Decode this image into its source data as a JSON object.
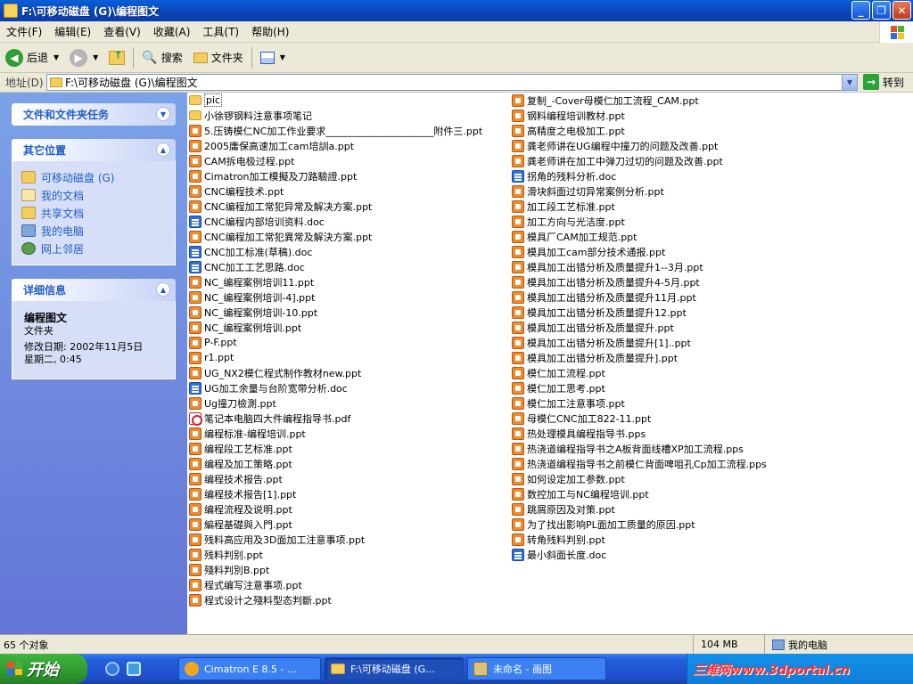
{
  "window": {
    "title": "F:\\可移动磁盘 (G)\\编程图文",
    "minimize": "_",
    "maximize": "❐",
    "close": "✕"
  },
  "menu": [
    "文件(F)",
    "编辑(E)",
    "查看(V)",
    "收藏(A)",
    "工具(T)",
    "帮助(H)"
  ],
  "toolbar": {
    "back": "后退",
    "search": "搜索",
    "folders": "文件夹"
  },
  "address": {
    "label": "地址(D)",
    "path": "F:\\可移动磁盘 (G)\\编程图文",
    "go": "转到"
  },
  "tasks": {
    "file_tasks_title": "文件和文件夹任务",
    "other_places_title": "其它位置",
    "other_places": [
      "可移动磁盘 (G)",
      "我的文档",
      "共享文档",
      "我的电脑",
      "网上邻居"
    ],
    "details_title": "详细信息",
    "details": {
      "name": "编程图文",
      "type": "文件夹",
      "modified": "修改日期: 2002年11月5日",
      "time": "星期二, 0:45"
    }
  },
  "files_col1": [
    {
      "name": "pic",
      "type": "folder"
    },
    {
      "name": "小徐锣钢料注意事项笔记",
      "type": "folder"
    },
    {
      "name": "5.压铸模仁NC加工作业要求______________________附件三.ppt",
      "type": "ppt"
    },
    {
      "name": "2005庸保高速加工cam培訓a.ppt",
      "type": "ppt"
    },
    {
      "name": "CAM拆电极过程.ppt",
      "type": "ppt"
    },
    {
      "name": "Cimatron加工模擬及刀路驗證.ppt",
      "type": "ppt"
    },
    {
      "name": "CNC编程技术.ppt",
      "type": "ppt"
    },
    {
      "name": "CNC编程加工常犯异常及解决方案.ppt",
      "type": "ppt"
    },
    {
      "name": "CNC编程内部培训资料.doc",
      "type": "doc"
    },
    {
      "name": "CNC编程加工常犯異常及解決方案.ppt",
      "type": "ppt"
    },
    {
      "name": "CNC加工标准(草稿).doc",
      "type": "doc"
    },
    {
      "name": "CNC加工工艺思路.doc",
      "type": "doc"
    },
    {
      "name": "NC_编程案例培训11.ppt",
      "type": "ppt"
    },
    {
      "name": "NC_编程案例培训-4].ppt",
      "type": "ppt"
    },
    {
      "name": "NC_编程案例培训-10.ppt",
      "type": "ppt"
    },
    {
      "name": "NC_编程案例培训.ppt",
      "type": "ppt"
    },
    {
      "name": "P-F.ppt",
      "type": "ppt"
    },
    {
      "name": "r1.ppt",
      "type": "ppt"
    },
    {
      "name": "UG_NX2模仁程式制作教材new.ppt",
      "type": "ppt"
    },
    {
      "name": "UG加工余量与台阶宽带分析.doc",
      "type": "doc"
    },
    {
      "name": "Ug撞刀檢測.ppt",
      "type": "ppt"
    },
    {
      "name": "笔记本电脑四大件编程指导书.pdf",
      "type": "pdf"
    },
    {
      "name": "编程标准-编程培训.ppt",
      "type": "ppt"
    },
    {
      "name": "编程段工艺标准.ppt",
      "type": "ppt"
    },
    {
      "name": "编程及加工策略.ppt",
      "type": "ppt"
    },
    {
      "name": "编程技术报告.ppt",
      "type": "ppt"
    },
    {
      "name": "编程技术报告[1].ppt",
      "type": "ppt"
    },
    {
      "name": "编程流程及说明.ppt",
      "type": "ppt"
    },
    {
      "name": "編程基礎與入門.ppt",
      "type": "ppt"
    },
    {
      "name": "残料高应用及3D面加工注意事项.ppt",
      "type": "ppt"
    },
    {
      "name": "残料判别.ppt",
      "type": "ppt"
    },
    {
      "name": "殘料判別B.ppt",
      "type": "ppt"
    },
    {
      "name": "程式编写注意事项.ppt",
      "type": "ppt"
    },
    {
      "name": "程式设计之殘料型态判斷.ppt",
      "type": "ppt"
    }
  ],
  "files_col2": [
    {
      "name": "复制_-Cover母模仁加工流程_CAM.ppt",
      "type": "ppt"
    },
    {
      "name": "钢料编程培训教材.ppt",
      "type": "ppt"
    },
    {
      "name": "高精度之电极加工.ppt",
      "type": "ppt"
    },
    {
      "name": "龚老师讲在UG编程中撞刀的问题及改善.ppt",
      "type": "ppt"
    },
    {
      "name": "龚老师讲在加工中弹刀过切的问题及改善.ppt",
      "type": "ppt"
    },
    {
      "name": "拐角的残料分析.doc",
      "type": "doc"
    },
    {
      "name": "滑块斜面过切异常案例分析.ppt",
      "type": "ppt"
    },
    {
      "name": "加工段工艺标准.ppt",
      "type": "ppt"
    },
    {
      "name": "加工方向与光洁度.ppt",
      "type": "ppt"
    },
    {
      "name": "模具厂CAM加工规范.ppt",
      "type": "ppt"
    },
    {
      "name": "模具加工cam部分技术通报.ppt",
      "type": "ppt"
    },
    {
      "name": "模具加工出错分析及质量提升1--3月.ppt",
      "type": "ppt"
    },
    {
      "name": "模具加工出错分析及质量提升4-5月.ppt",
      "type": "ppt"
    },
    {
      "name": "模具加工出错分析及质量提升11月.ppt",
      "type": "ppt"
    },
    {
      "name": "模具加工出错分析及质量提升12.ppt",
      "type": "ppt"
    },
    {
      "name": "模具加工出错分析及质量提升.ppt",
      "type": "ppt"
    },
    {
      "name": "模具加工出错分析及质量提升[1]..ppt",
      "type": "ppt"
    },
    {
      "name": "模具加工出错分析及质量提升].ppt",
      "type": "ppt"
    },
    {
      "name": "模仁加工流程.ppt",
      "type": "ppt"
    },
    {
      "name": "模仁加工思考.ppt",
      "type": "ppt"
    },
    {
      "name": "模仁加工注意事项.ppt",
      "type": "ppt"
    },
    {
      "name": "母模仁CNC加工822-11.ppt",
      "type": "ppt"
    },
    {
      "name": "热处理模具编程指导书.pps",
      "type": "ppt"
    },
    {
      "name": "热浇道编程指导书之A板背面线槽XP加工流程.pps",
      "type": "ppt"
    },
    {
      "name": "热浇道编程指导书之前模仁背面啤咀孔Cp加工流程.pps",
      "type": "ppt"
    },
    {
      "name": "如何设定加工参数.ppt",
      "type": "ppt"
    },
    {
      "name": "数控加工与NC编程培训.ppt",
      "type": "ppt"
    },
    {
      "name": "跳屑原因及对策.ppt",
      "type": "ppt"
    },
    {
      "name": "为了找出影响PL面加工质量的原因.ppt",
      "type": "ppt"
    },
    {
      "name": "转角残料判别.ppt",
      "type": "ppt"
    },
    {
      "name": "最小斜面长度.doc",
      "type": "doc"
    }
  ],
  "status": {
    "count": "65 个对象",
    "size": "104 MB",
    "location": "我的电脑"
  },
  "taskbar": {
    "start": "开始",
    "tasks": [
      "Cimatron E 8.5 - ...",
      "F:\\可移动磁盘 (G...",
      "未命名 - 画图"
    ],
    "watermark": "三维网www.3dportal.cn"
  }
}
